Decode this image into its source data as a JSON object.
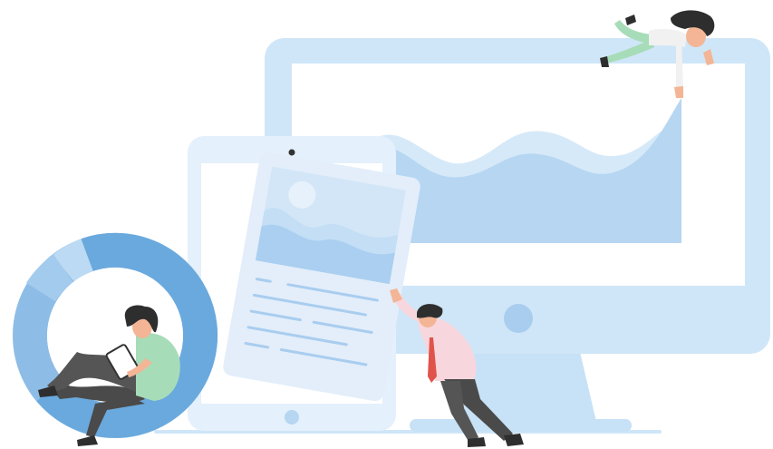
{
  "illustration": {
    "icons": [
      "desktop-monitor-icon",
      "tablet-icon",
      "document-card-icon",
      "donut-chart-icon",
      "area-chart-icon",
      "person-flying-icon",
      "person-pushing-icon",
      "person-reading-icon"
    ]
  },
  "colors": {
    "background": "#ffffff",
    "monitor_frame": "#cfe6f8",
    "screen": "#ffffff",
    "chart_light": "#d6e9f8",
    "chart_mid": "#b6d6f2",
    "monitor_button": "#a8cdee",
    "tablet": "#e4f0fb",
    "card": "#e3eefa",
    "card_lines": "#a9cdef",
    "donut_dark": "#6aa9dd",
    "donut_mid": "#8dbde6",
    "donut_light": "#bcdaf3",
    "shirt_pink": "#f7d7dd",
    "shirt_green": "#a7dcb8",
    "pants_dark": "#4a4a4a",
    "hair": "#2e2e2e",
    "skin": "#f3b595",
    "tie": "#e0534a",
    "floor": "#cfe6f8"
  }
}
